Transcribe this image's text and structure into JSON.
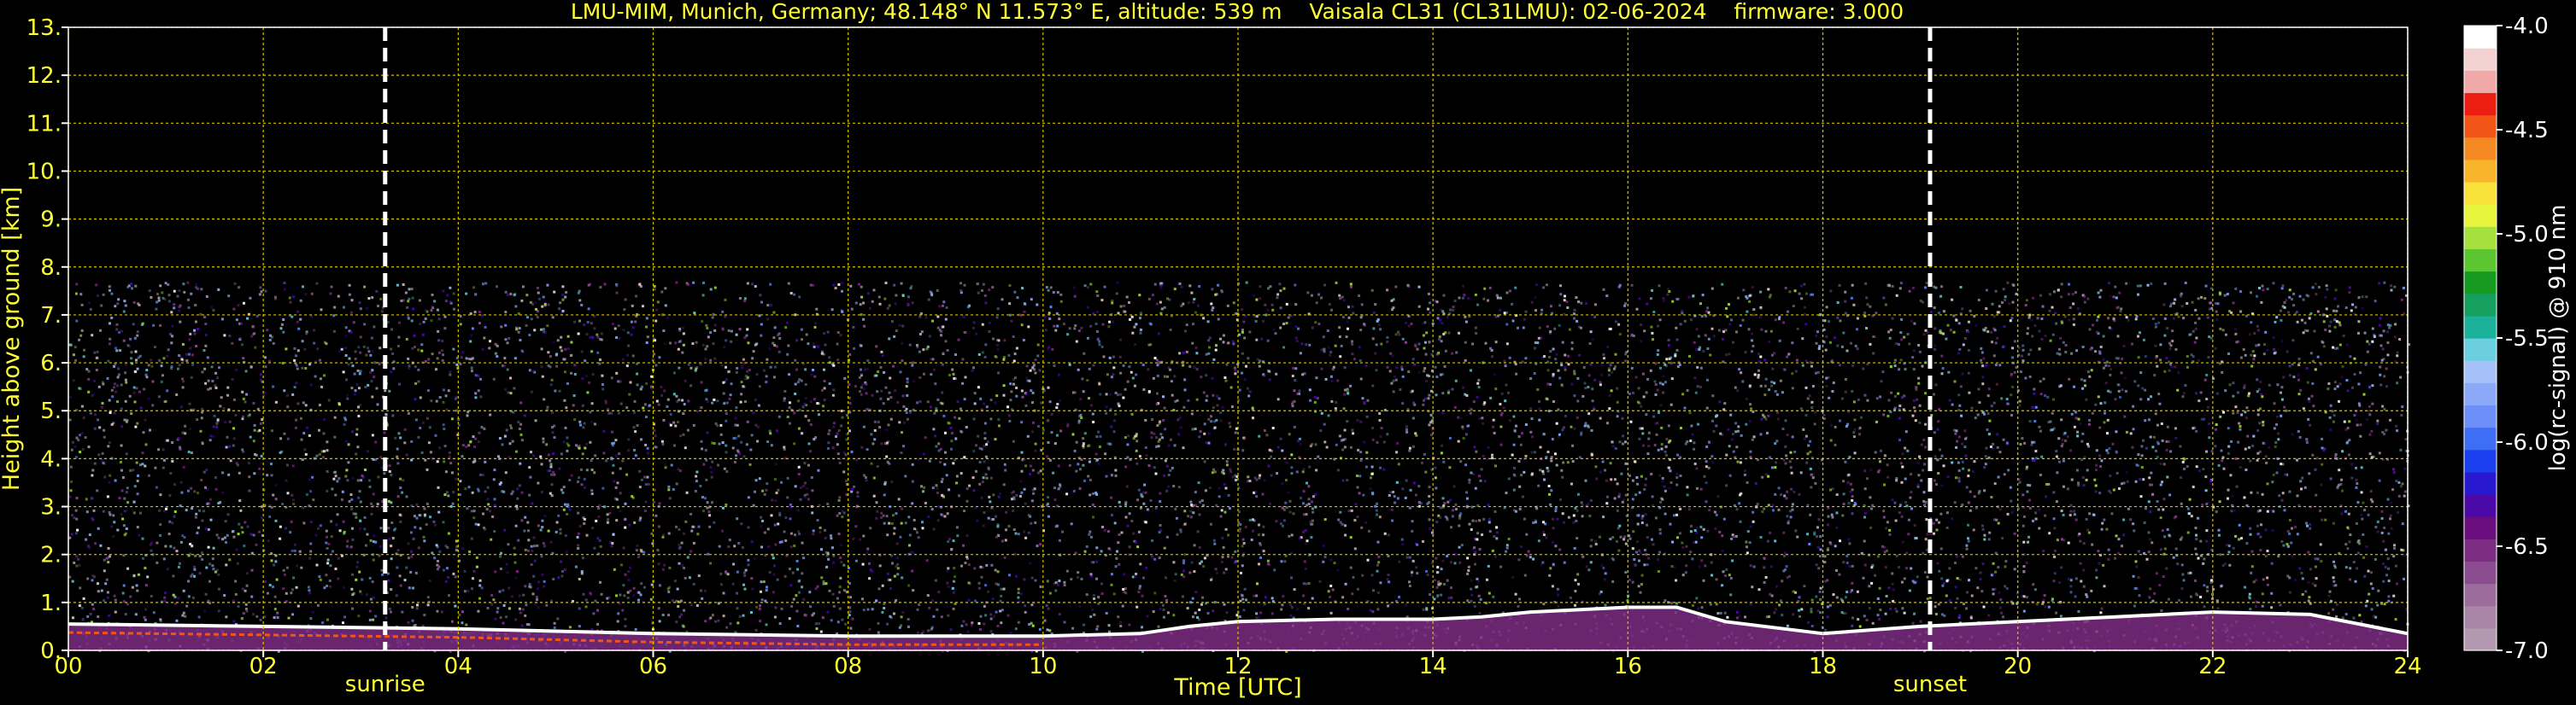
{
  "chart_data": {
    "type": "heatmap",
    "title": "LMU-MIM, Munich, Germany; 48.148° N 11.573° E, altitude: 539 m    Vaisala CL31 (CL31LMU): 02-06-2024    firmware: 3.000",
    "xlabel": "Time [UTC]",
    "ylabel": "Height above ground [km]",
    "xlim": [
      0,
      24
    ],
    "ylim": [
      0,
      13
    ],
    "x_ticks": [
      "00",
      "02",
      "04",
      "06",
      "08",
      "10",
      "12",
      "14",
      "16",
      "18",
      "20",
      "22",
      "24"
    ],
    "y_ticks": [
      "0.",
      "1.",
      "2.",
      "3.",
      "4.",
      "5.",
      "6.",
      "7.",
      "8.",
      "9.",
      "10.",
      "11.",
      "12.",
      "13."
    ],
    "grid": true,
    "grid_color": "#d4c400",
    "text_color": "#ffff33",
    "background": "#000000",
    "annotations": [
      {
        "label": "sunrise",
        "x": 3.25
      },
      {
        "label": "sunset",
        "x": 19.1
      }
    ],
    "data_extent": {
      "top_km": 7.7,
      "noise_dense_top_km": 5.5
    },
    "boundary_layer_top_km": [
      {
        "x": 0,
        "y": 0.55
      },
      {
        "x": 2,
        "y": 0.5
      },
      {
        "x": 4,
        "y": 0.45
      },
      {
        "x": 6,
        "y": 0.35
      },
      {
        "x": 8,
        "y": 0.3
      },
      {
        "x": 10,
        "y": 0.3
      },
      {
        "x": 11,
        "y": 0.35
      },
      {
        "x": 11.5,
        "y": 0.5
      },
      {
        "x": 12,
        "y": 0.6
      },
      {
        "x": 13,
        "y": 0.65
      },
      {
        "x": 14,
        "y": 0.65
      },
      {
        "x": 14.5,
        "y": 0.7
      },
      {
        "x": 15,
        "y": 0.8
      },
      {
        "x": 16,
        "y": 0.9
      },
      {
        "x": 16.5,
        "y": 0.9
      },
      {
        "x": 17,
        "y": 0.6
      },
      {
        "x": 18,
        "y": 0.35
      },
      {
        "x": 19,
        "y": 0.5
      },
      {
        "x": 20,
        "y": 0.6
      },
      {
        "x": 21,
        "y": 0.7
      },
      {
        "x": 22,
        "y": 0.8
      },
      {
        "x": 23,
        "y": 0.75
      },
      {
        "x": 24,
        "y": 0.35
      }
    ],
    "colorbar": {
      "label": "log(rc-signal) @ 910 nm",
      "range": [
        -7.0,
        -4.0
      ],
      "ticks": [
        "-4.0",
        "-4.5",
        "-5.0",
        "-5.5",
        "-6.0",
        "-6.5",
        "-7.0"
      ],
      "colors": [
        "#b399b0",
        "#a884a6",
        "#9c6c9c",
        "#8a4c8f",
        "#7d2c83",
        "#6a0d7d",
        "#4b0aa8",
        "#2818d0",
        "#1c3ff0",
        "#3d6ef5",
        "#6c8ef8",
        "#8ca8f8",
        "#a6c0fa",
        "#6ccfe0",
        "#1ab09a",
        "#15a060",
        "#169a20",
        "#5cc630",
        "#a6e03c",
        "#e6f43c",
        "#f8e23a",
        "#f8b52c",
        "#f68a22",
        "#f25518",
        "#ec1e12",
        "#f0a8a8",
        "#f4d2d2",
        "#ffffff"
      ]
    }
  }
}
